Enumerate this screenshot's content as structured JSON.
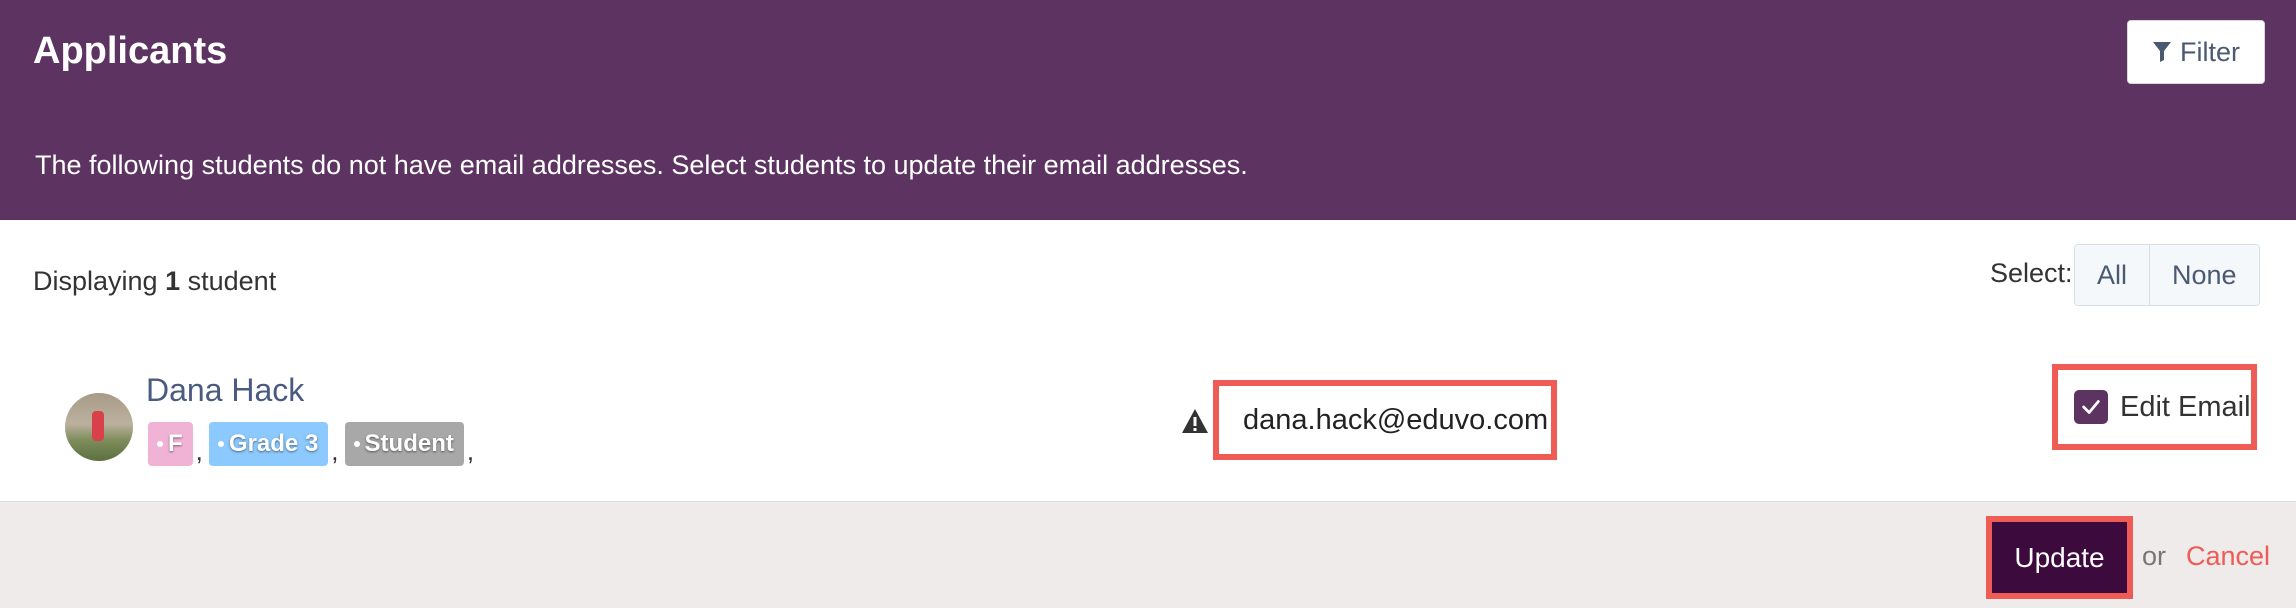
{
  "header": {
    "title": "Applicants",
    "filter_label": "Filter",
    "filter_icon": "filter-icon",
    "instructions": "The following students do not have email addresses. Select students to update their email addresses."
  },
  "list": {
    "display_prefix": "Displaying",
    "display_count": "1",
    "display_suffix": "student",
    "select_label": "Select:",
    "select_all": "All",
    "select_none": "None"
  },
  "student": {
    "name": "Dana Hack",
    "tags": [
      {
        "label": "F",
        "color": "#f0b3d6"
      },
      {
        "label": "Grade 3",
        "color": "#8cc9ff"
      },
      {
        "label": "Student",
        "color": "#a8a8a8"
      }
    ],
    "email": "dana.hack@eduvo.com",
    "edit_email_label": "Edit Email",
    "edit_email_checked": true
  },
  "footer": {
    "update_label": "Update",
    "or_text": "or",
    "cancel_label": "Cancel"
  },
  "colors": {
    "header_bg": "#5d3461",
    "highlight": "#ef5c55",
    "update_bg": "#3d0a3e",
    "cancel": "#ef5c55"
  }
}
